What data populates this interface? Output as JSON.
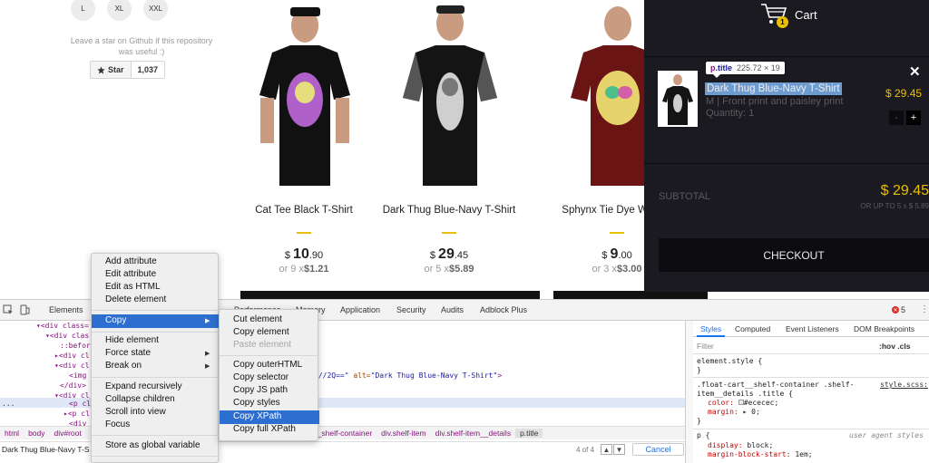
{
  "store": {
    "sizes": [
      "L",
      "XL",
      "XXL"
    ],
    "github_text": "Leave a star on Github if this repository was useful :)",
    "star_label": "Star",
    "star_count": "1,037",
    "products": [
      {
        "title": "Cat Tee Black T-Shirt",
        "currency": "$",
        "price_int": "10",
        "price_dec": ".90",
        "inst_prefix": "or 9 x",
        "inst_value": "$1.21",
        "shirt_color": "#111111",
        "print_color": "#b061c9"
      },
      {
        "title": "Dark Thug Blue-Navy T-Shirt",
        "currency": "$",
        "price_int": "29",
        "price_dec": ".45",
        "inst_prefix": "or 5 x",
        "inst_value": "$5.89",
        "shirt_color": "#141414",
        "print_color": "#cfcfcf"
      },
      {
        "title": "Sphynx Tie Dye W Shirt",
        "currency": "$",
        "price_int": "9",
        "price_dec": ".00",
        "inst_prefix": "or 3 x",
        "inst_value": "$3.00",
        "shirt_color": "#6a1414",
        "print_color": "#e7d36b"
      }
    ]
  },
  "cart": {
    "title": "Cart",
    "badge": "1",
    "tooltip_tag": "p",
    "tooltip_class": ".title",
    "tooltip_dims": "225.72 × 19",
    "item_title": "Dark Thug Blue-Navy T-Shirt",
    "item_desc": "M | Front print and paisley print",
    "item_qty": "Quantity: 1",
    "close": "✕",
    "item_price": "$ 29.45",
    "minus": "-",
    "plus": "+",
    "subtotal_label": "SUBTOTAL",
    "subtotal_value": "$ 29.45",
    "subtotal_inst": "OR UP TO 5 x $ 5.89",
    "checkout": "CHECKOUT",
    "accent": "#eabf00"
  },
  "devtools": {
    "tabs": [
      "Elements",
      "Performance",
      "Memory",
      "Application",
      "Security",
      "Audits",
      "Adblock Plus"
    ],
    "error_count": "5",
    "dom": [
      "▾<div class=",
      "▾<div clas",
      "::befor",
      "▸<div cl",
      "▾<div cl",
      "<img",
      "</div>",
      "▾<div cl",
      "<p cl",
      "▸<p cl",
      "<div cl"
    ],
    "img_tail_value": "B//2Q==\"",
    "img_tail_alt_attr": " alt=",
    "img_tail_alt_value": "\"Dark Thug Blue-Navy T-Shirt\"",
    "img_tail_close": ">",
    "ellipsis": "...",
    "breadcrumbs": [
      "html",
      "body",
      "div#root",
      "rt__shelf-container",
      "div.shelf-item",
      "div.shelf-item__details",
      "p.title"
    ],
    "search_text": "Dark Thug Blue-Navy T-S",
    "search_count": "4 of 4",
    "search_up": "▲",
    "search_down": "▼",
    "search_cancel": "Cancel",
    "styles_tabs": [
      "Styles",
      "Computed",
      "Event Listeners",
      "DOM Breakpoints"
    ],
    "filter_placeholder": "Filter",
    "hov_cls": ":hov  .cls",
    "rule1_selector": "element.style {",
    "rule1_close": "}",
    "rule2_selector_a": ".float-cart__shelf-container .shelf-",
    "rule2_selector_b": "item__details .title {",
    "rule2_source": "style.scss:",
    "rule2_color_prop": "color:",
    "rule2_color_value": "#ececec;",
    "rule2_margin_prop": "margin:",
    "rule2_margin_value": "▸ 0;",
    "rule2_close": "}",
    "rule3_selector": "p {",
    "rule3_source": "user agent styles",
    "rule3_display_prop": "display:",
    "rule3_display_value": "block;",
    "rule3_mbs_prop": "margin-block-start:",
    "rule3_mbs_value": "1em;"
  },
  "context_menu": {
    "items": [
      "Add attribute",
      "Edit attribute",
      "Edit as HTML",
      "Delete element",
      "Copy",
      "Hide element",
      "Force state",
      "Break on",
      "Expand recursively",
      "Collapse children",
      "Scroll into view",
      "Focus",
      "Store as global variable"
    ],
    "submenu": [
      "Cut element",
      "Copy element",
      "Paste element",
      "Copy outerHTML",
      "Copy selector",
      "Copy JS path",
      "Copy styles",
      "Copy XPath",
      "Copy full XPath"
    ],
    "highlighted": "Copy",
    "sub_highlighted": "Copy XPath",
    "highlight_color": "#2d6fd1"
  }
}
